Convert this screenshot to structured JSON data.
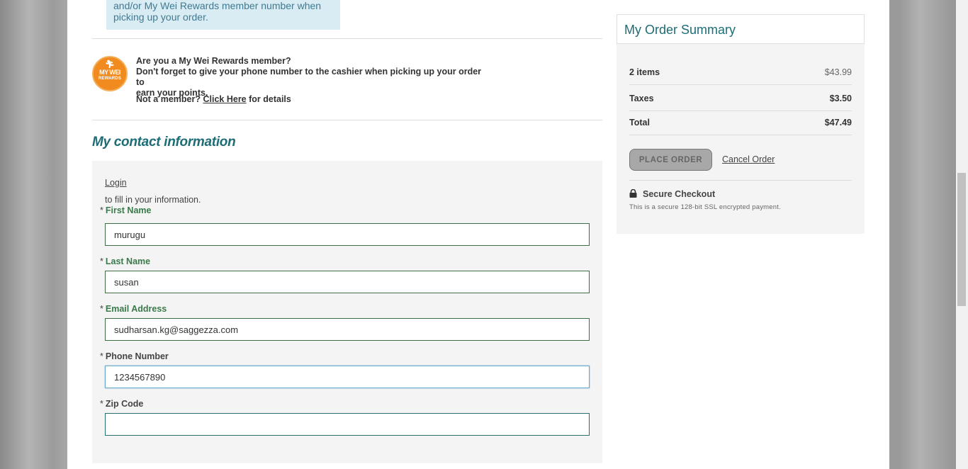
{
  "notice": {
    "line1": "and/or My Wei Rewards member number when",
    "line2": "picking up your order."
  },
  "rewards": {
    "logo_text_line1": "MY WEI",
    "logo_text_line2": "REWARDS",
    "question": "Are you a My Wei Rewards member?",
    "reminder_line1": "Don't forget to give your phone number to the cashier when picking up your order to",
    "reminder_line2": "earn your points.",
    "not_member_prefix": "Not a member?",
    "click_here": "Click Here",
    "details_suffix": "for details"
  },
  "contact": {
    "title": "My contact information",
    "login_link": "Login",
    "fill_text": "to fill in your information.",
    "required_marker": "*",
    "fields": [
      {
        "label": "First Name",
        "value": "murugu"
      },
      {
        "label": "Last Name",
        "value": "susan"
      },
      {
        "label": "Email Address",
        "value": "sudharsan.kg@saggezza.com"
      },
      {
        "label": "Phone Number",
        "value": "1234567890"
      },
      {
        "label": "Zip Code",
        "value": ""
      }
    ]
  },
  "summary": {
    "title": "My Order Summary",
    "rows": [
      {
        "label": "2 items",
        "value": "$43.99"
      },
      {
        "label": "Taxes",
        "value": "$3.50"
      },
      {
        "label": "Total",
        "value": "$47.49"
      }
    ],
    "place_order": "PLACE ORDER",
    "cancel_order": "Cancel Order",
    "secure_title": "Secure Checkout",
    "secure_desc": "This is a secure 128-bit SSL encrypted payment."
  },
  "icons": {
    "logo": "my-wei-rewards-logo",
    "lock": "lock-icon"
  },
  "colors": {
    "accent_teal": "#1d6d76",
    "label_green": "#3a7a4a",
    "notice_bg": "#d9ecf3",
    "logo_orange": "#f18a1f"
  }
}
